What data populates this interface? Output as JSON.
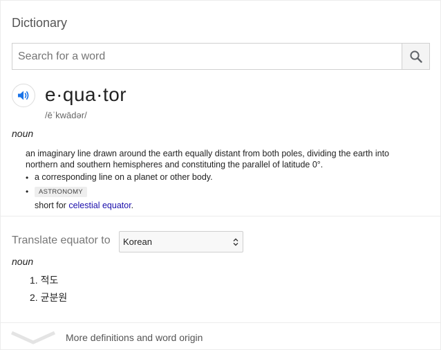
{
  "card": {
    "title": "Dictionary",
    "search": {
      "placeholder": "Search for a word",
      "value": "",
      "button_icon": "search-icon"
    },
    "entry": {
      "audio_icon": "speaker-icon",
      "headword": "e·qua·tor",
      "phonetic": "/ēˈkwādər/",
      "part_of_speech": "noun",
      "definition": "an imaginary line drawn around the earth equally distant from both poles, dividing the earth into northern and southern hemispheres and constituting the parallel of latitude 0°.",
      "sub_definitions": [
        {
          "text": "a corresponding line on a planet or other body."
        },
        {
          "label": "ASTRONOMY",
          "short_prefix": "short for ",
          "link_text": "celestial equator",
          "suffix": "."
        }
      ]
    },
    "translate": {
      "label": "Translate equator to",
      "selected_language": "Korean",
      "part_of_speech": "noun",
      "translations": [
        {
          "index": "1.",
          "text": "적도"
        },
        {
          "index": "2.",
          "text": "균분원"
        }
      ]
    },
    "more": {
      "icon": "chevron-down-icon",
      "label": "More definitions and word origin"
    }
  }
}
